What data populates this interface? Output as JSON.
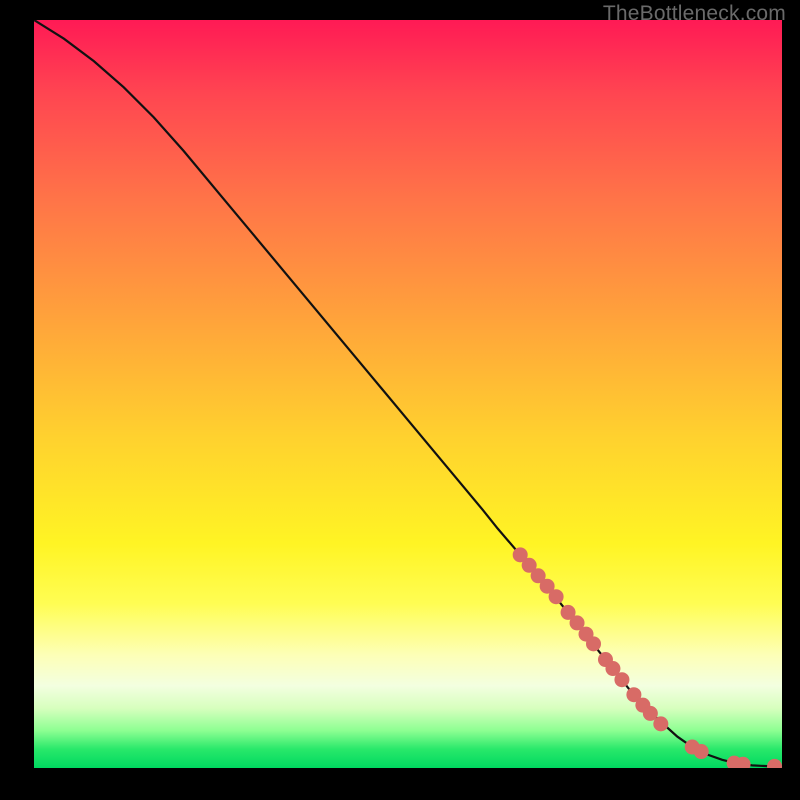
{
  "watermark": "TheBottleneck.com",
  "chart_data": {
    "type": "line",
    "title": "",
    "xlabel": "",
    "ylabel": "",
    "xlim": [
      0,
      100
    ],
    "ylim": [
      0,
      100
    ],
    "grid": false,
    "series": [
      {
        "name": "curve",
        "x": [
          0,
          4,
          8,
          12,
          16,
          20,
          25,
          30,
          35,
          40,
          45,
          50,
          55,
          60,
          62,
          65,
          68,
          70,
          72,
          74,
          76,
          78,
          80,
          82,
          84,
          86,
          88,
          90,
          92,
          94,
          96,
          98,
          100
        ],
        "y": [
          100,
          97.5,
          94.5,
          91,
          87,
          82.5,
          76.5,
          70.5,
          64.5,
          58.5,
          52.5,
          46.5,
          40.5,
          34.5,
          32,
          28.5,
          25,
          22.5,
          20,
          17.5,
          15,
          12.5,
          10,
          7.8,
          6,
          4.2,
          2.8,
          1.8,
          1.1,
          0.6,
          0.35,
          0.25,
          0.2
        ]
      }
    ],
    "markers": [
      {
        "x": 65.0,
        "y": 28.5
      },
      {
        "x": 66.2,
        "y": 27.1
      },
      {
        "x": 67.4,
        "y": 25.7
      },
      {
        "x": 68.6,
        "y": 24.3
      },
      {
        "x": 69.8,
        "y": 22.9
      },
      {
        "x": 71.4,
        "y": 20.8
      },
      {
        "x": 72.6,
        "y": 19.4
      },
      {
        "x": 73.8,
        "y": 17.9
      },
      {
        "x": 74.8,
        "y": 16.6
      },
      {
        "x": 76.4,
        "y": 14.5
      },
      {
        "x": 77.4,
        "y": 13.3
      },
      {
        "x": 78.6,
        "y": 11.8
      },
      {
        "x": 80.2,
        "y": 9.8
      },
      {
        "x": 81.4,
        "y": 8.4
      },
      {
        "x": 82.4,
        "y": 7.3
      },
      {
        "x": 83.8,
        "y": 5.9
      },
      {
        "x": 88.0,
        "y": 2.8
      },
      {
        "x": 89.2,
        "y": 2.2
      },
      {
        "x": 93.6,
        "y": 0.65
      },
      {
        "x": 94.8,
        "y": 0.5
      },
      {
        "x": 99.0,
        "y": 0.22
      }
    ],
    "colors": {
      "line": "#111111",
      "marker": "#d86b66"
    }
  }
}
